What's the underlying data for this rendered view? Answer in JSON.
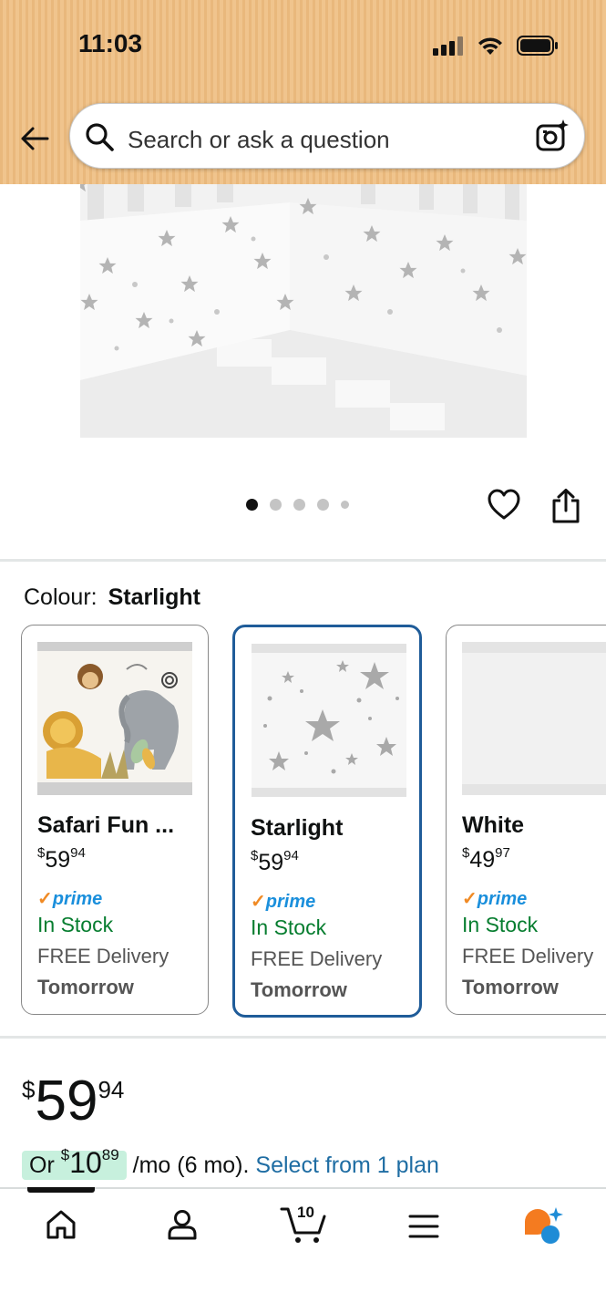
{
  "status_bar": {
    "time": "11:03"
  },
  "search": {
    "placeholder": "Search or ask a question"
  },
  "carousel": {
    "count": 5,
    "active_index": 0
  },
  "colour": {
    "label": "Colour:",
    "selected": "Starlight"
  },
  "variants": [
    {
      "name": "Safari Fun ...",
      "price_dollars": "59",
      "price_cents": "94",
      "prime": "prime",
      "stock": "In Stock",
      "delivery": "FREE Delivery",
      "when": "Tomorrow",
      "selected": false
    },
    {
      "name": "Starlight",
      "price_dollars": "59",
      "price_cents": "94",
      "prime": "prime",
      "stock": "In Stock",
      "delivery": "FREE Delivery",
      "when": "Tomorrow",
      "selected": true
    },
    {
      "name": "White",
      "price_dollars": "49",
      "price_cents": "97",
      "prime": "prime",
      "stock": "In Stock",
      "delivery": "FREE Delivery",
      "when": "Tomorrow",
      "selected": false
    }
  ],
  "currency": "$",
  "main_price": {
    "dollars": "59",
    "cents": "94"
  },
  "plan": {
    "prefix": "Or ",
    "dollars": "10",
    "cents": "89",
    "suffix": " /mo (6 mo).",
    "link": "Select from 1 plan"
  },
  "nav": {
    "cart_count": "10",
    "items": [
      "home-icon",
      "account-icon",
      "cart-icon",
      "menu-icon",
      "rufus-icon"
    ]
  },
  "colors": {
    "header": "#f0c48d",
    "selected_border": "#1f5c99",
    "prime": "#1a8fdc",
    "in_stock": "#067d2f",
    "link": "#1f6da3"
  }
}
